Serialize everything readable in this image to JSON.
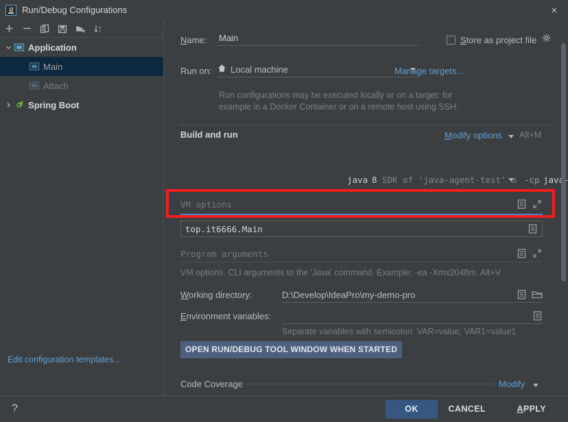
{
  "window": {
    "title": "Run/Debug Configurations",
    "app_icon": "intellij-idea-icon",
    "close_label": "×"
  },
  "toolbar": {
    "items": [
      {
        "name": "add-configuration-button",
        "icon": "plus-icon",
        "label": "+"
      },
      {
        "name": "remove-configuration-button",
        "icon": "minus-icon",
        "label": "−"
      },
      {
        "name": "copy-configuration-button",
        "icon": "copy-icon",
        "label": "Copy"
      },
      {
        "name": "save-configuration-button",
        "icon": "save-icon",
        "label": "Save"
      },
      {
        "name": "new-folder-button",
        "icon": "new-folder-icon",
        "label": "New Folder"
      },
      {
        "name": "sort-configurations-button",
        "icon": "sort-alphabetically-icon",
        "label": "Sort"
      }
    ]
  },
  "sidebar": {
    "tree": [
      {
        "label": "Application",
        "icon": "application-icon",
        "expanded": true,
        "level": 0,
        "style": "bold"
      },
      {
        "label": "Main",
        "icon": "application-icon",
        "level": 1,
        "selected": true,
        "style": "dim"
      },
      {
        "label": "Attach",
        "icon": "application-icon",
        "level": 1,
        "selected": false,
        "style": "dimmer"
      },
      {
        "label": "Spring Boot",
        "icon": "spring-boot-icon",
        "expanded": false,
        "level": 0,
        "style": "bold"
      }
    ],
    "edit_templates_link": "Edit configuration templates..."
  },
  "main": {
    "name_label": "Name:",
    "name_label_mnemonic": "N",
    "name_value": "Main",
    "store_as_project_file_label": "Store as project file",
    "store_as_project_file_mnemonic": "S",
    "store_as_project_file_checked": false,
    "store_settings_icon": "gear-icon",
    "run_on_label": "Run on:",
    "run_on_value": "Local machine",
    "run_on_icon": "home-icon",
    "manage_targets_link": "Manage targets...",
    "run_on_hint_line1": "Run configurations may be executed locally or on a target: for",
    "run_on_hint_line2": "example in a Docker Container or on a remote host using SSH.",
    "build_and_run_title": "Build and run",
    "modify_options_link": "Modify options",
    "modify_options_shortcut": "Alt+M",
    "jdk_java": "java",
    "jdk_version": "8",
    "jdk_desc": "SDK of 'java-agent-test' m",
    "cp_flag": "-cp",
    "cp_module": "java-agent-test",
    "vm_options_placeholder": "VM options",
    "vm_options_value": "",
    "main_class_value": "top.it6666.Main",
    "program_arguments_placeholder": "Program arguments",
    "vm_options_hint": "VM options. CLI arguments to the 'Java' command. Example: -ea -Xmx2048m. Alt+V",
    "working_directory_label": "Working directory:",
    "working_directory_mnemonic": "W",
    "working_directory_value": "D:\\Develop\\IdeaPro\\my-demo-pro",
    "environment_variables_label": "Environment variables:",
    "environment_variables_mnemonic": "E",
    "environment_variables_value": "",
    "environment_variables_hint": "Separate variables with semicolon: VAR=value; VAR1=value1",
    "open_tool_window_button": "OPEN RUN/DEBUG TOOL WINDOW WHEN STARTED",
    "code_coverage_title": "Code Coverage",
    "code_coverage_modify_link": "Modify",
    "expand_icon": "expand-icon",
    "list_icon": "list-icon",
    "browse_icon": "folder-icon"
  },
  "footer": {
    "help_label": "?",
    "ok_label": "OK",
    "cancel_label": "CANCEL",
    "apply_label": "APPLY",
    "apply_mnemonic": "A"
  },
  "annotation": {
    "highlight_color": "#f31d1d",
    "target": "vm-options-field"
  },
  "colors": {
    "background": "#3c3f41",
    "selection": "#0d293f",
    "link": "#5f9fd4",
    "accent": "#4a88c7",
    "primary_button": "#365880"
  }
}
